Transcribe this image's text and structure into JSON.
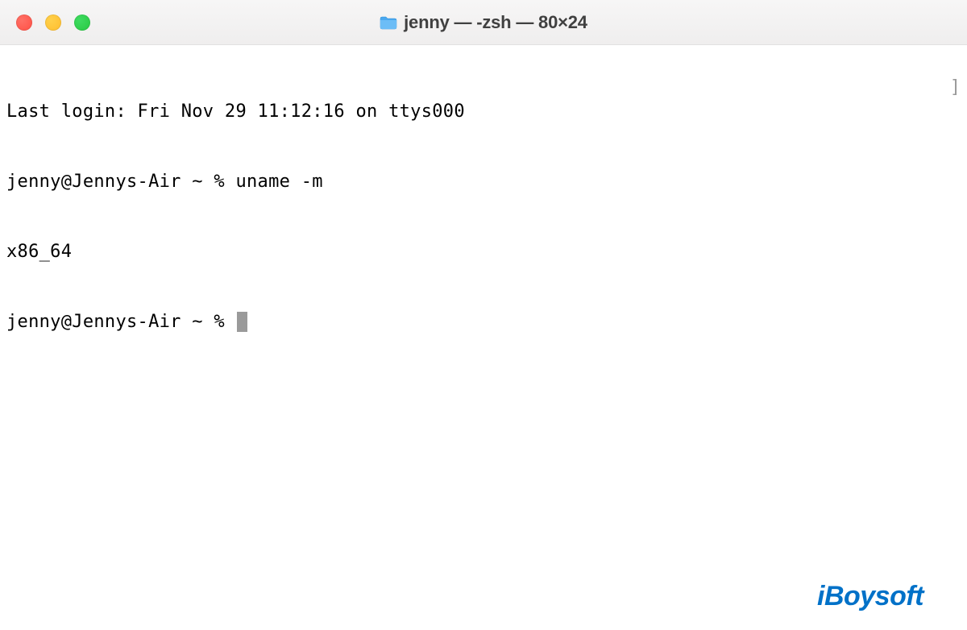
{
  "titlebar": {
    "title": "jenny — -zsh — 80×24"
  },
  "terminal": {
    "line1": "Last login: Fri Nov 29 11:12:16 on ttys000",
    "line2": "jenny@Jennys-Air ~ % uname -m",
    "line3": "x86_64",
    "line4_prompt": "jenny@Jennys-Air ~ % "
  },
  "watermark": {
    "text": "iBoysoft"
  }
}
